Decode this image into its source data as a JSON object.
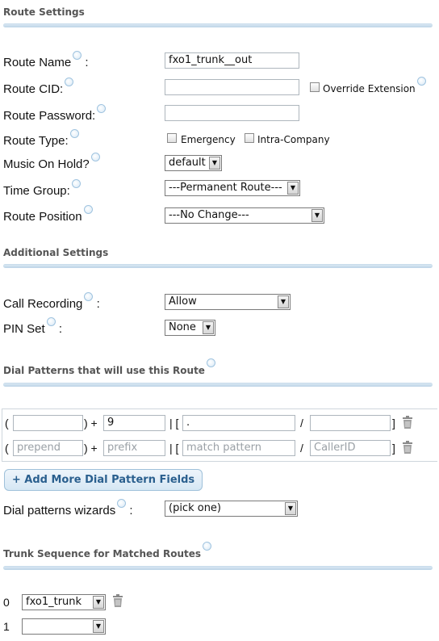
{
  "route_settings": {
    "title": "Route Settings",
    "route_name": {
      "label": "Route Name",
      "colon": ":",
      "value": "fxo1_trunk__out"
    },
    "route_cid": {
      "label": "Route CID:",
      "value": "",
      "override_label": "Override Extension",
      "override_checked": false
    },
    "route_password": {
      "label": "Route Password:",
      "value": ""
    },
    "route_type": {
      "label": "Route Type:",
      "emergency_label": "Emergency",
      "emergency_checked": false,
      "intra_label": "Intra-Company",
      "intra_checked": false
    },
    "music_on_hold": {
      "label": "Music On Hold?",
      "selected": "default"
    },
    "time_group": {
      "label": "Time Group:",
      "selected": "---Permanent Route---"
    },
    "route_position": {
      "label": "Route Position",
      "selected": "---No Change---"
    }
  },
  "additional_settings": {
    "title": "Additional Settings",
    "call_recording": {
      "label": "Call Recording",
      "colon": ":",
      "selected": "Allow"
    },
    "pin_set": {
      "label": "PIN Set",
      "colon": ":",
      "selected": "None"
    }
  },
  "dial_patterns": {
    "title": "Dial Patterns that will use this Route",
    "symbols": {
      "open_paren": "(",
      "close_paren_plus": ") +",
      "bar_bracket": "| [",
      "slash": "/",
      "close_bracket": "]"
    },
    "rows": [
      {
        "prepend": "",
        "prefix": "9",
        "match_pattern": ".",
        "caller_id": ""
      },
      {
        "prepend": "",
        "prefix": "",
        "match_pattern": "",
        "caller_id": ""
      }
    ],
    "placeholders": {
      "prepend": "prepend",
      "prefix": "prefix",
      "match_pattern": "match pattern",
      "caller_id": "CallerID"
    },
    "add_button": "+ Add More Dial Pattern Fields",
    "wizards": {
      "label": "Dial patterns wizards",
      "colon": ":",
      "selected": "(pick one)"
    }
  },
  "trunk_sequence": {
    "title": "Trunk Sequence for Matched Routes",
    "rows": [
      {
        "index": "0",
        "selected": "fxo1_trunk"
      },
      {
        "index": "1",
        "selected": ""
      }
    ]
  },
  "icons": {
    "help": "help-bubble-icon",
    "trash": "trash-icon",
    "dropdown": "dropdown-arrow-icon"
  },
  "colors": {
    "section_title": "#555555",
    "divider": "#bcd4e6",
    "button_text": "#2a5f8e"
  }
}
